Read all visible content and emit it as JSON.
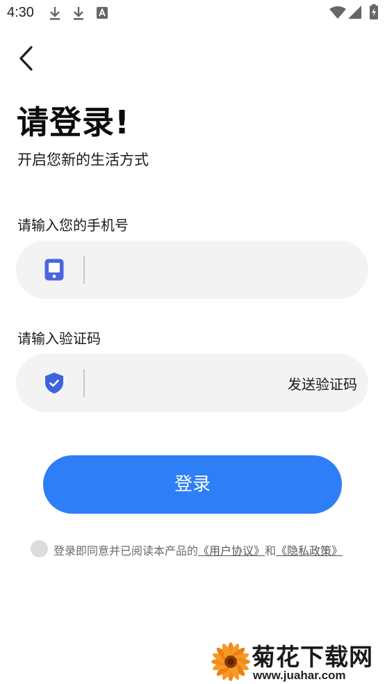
{
  "status_bar": {
    "time": "4:30",
    "left_icons": [
      "download-icon",
      "download-icon",
      "a-text-icon"
    ],
    "right_icons": [
      "wifi-icon",
      "signal-icon",
      "battery-charging-icon"
    ]
  },
  "header": {
    "back_icon": "chevron-left-icon"
  },
  "title": "请登录!",
  "subtitle": "开启您新的生活方式",
  "phone": {
    "label": "请输入您的手机号",
    "placeholder": "",
    "icon": "phone-icon",
    "value": ""
  },
  "code": {
    "label": "请输入验证码",
    "placeholder": "",
    "icon": "shield-check-icon",
    "value": "",
    "send_label": "发送验证码"
  },
  "login_button": "登录",
  "agreement": {
    "text": "登录即同意并已阅读本产品的",
    "user_agreement": "《用户协议》",
    "and": "和",
    "privacy_policy": "《隐私政策》",
    "checked": false
  },
  "watermark": {
    "title": "菊花下载网",
    "url": "www.juahar.com"
  },
  "colors": {
    "primary": "#2d7ef7",
    "phone_icon": "#4a67e0",
    "shield_icon": "#3e63dd",
    "field_bg": "#f3f3f3"
  }
}
